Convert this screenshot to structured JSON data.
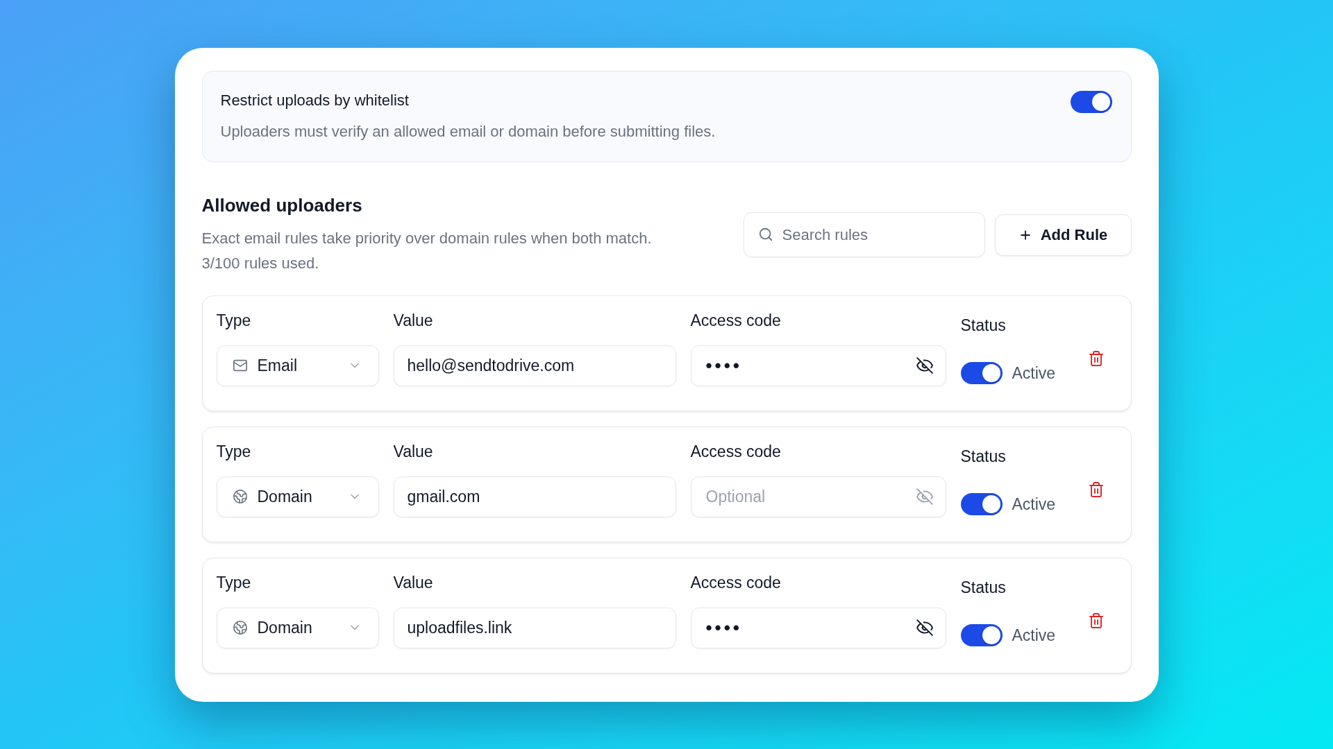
{
  "whitelist_setting": {
    "title": "Restrict uploads by whitelist",
    "description": "Uploaders must verify an allowed email or domain before submitting files.",
    "on": true
  },
  "allowed_uploaders": {
    "title": "Allowed uploaders",
    "description": "Exact email rules take priority over domain rules when both match.",
    "usage": "3/100 rules used.",
    "search": {
      "placeholder": "Search rules"
    },
    "add_button": "Add Rule"
  },
  "rules": [
    {
      "type_label": "Type",
      "type": {
        "kind": "email",
        "label": "Email"
      },
      "value_label": "Value",
      "value": "hello@sendtodrive.com",
      "access_code_label": "Access code",
      "access_code": {
        "value": "••••"
      },
      "status_label": "Status",
      "active": true,
      "status_text": "Active"
    },
    {
      "type_label": "Type",
      "type": {
        "kind": "domain",
        "label": "Domain"
      },
      "value_label": "Value",
      "value": "gmail.com",
      "access_code_label": "Access code",
      "access_code": {
        "placeholder": "Optional"
      },
      "status_label": "Status",
      "active": true,
      "status_text": "Active"
    },
    {
      "type_label": "Type",
      "type": {
        "kind": "domain",
        "label": "Domain"
      },
      "value_label": "Value",
      "value": "uploadfiles.link",
      "access_code_label": "Access code",
      "access_code": {
        "value": "••••"
      },
      "status_label": "Status",
      "active": true,
      "status_text": "Active"
    }
  ]
}
